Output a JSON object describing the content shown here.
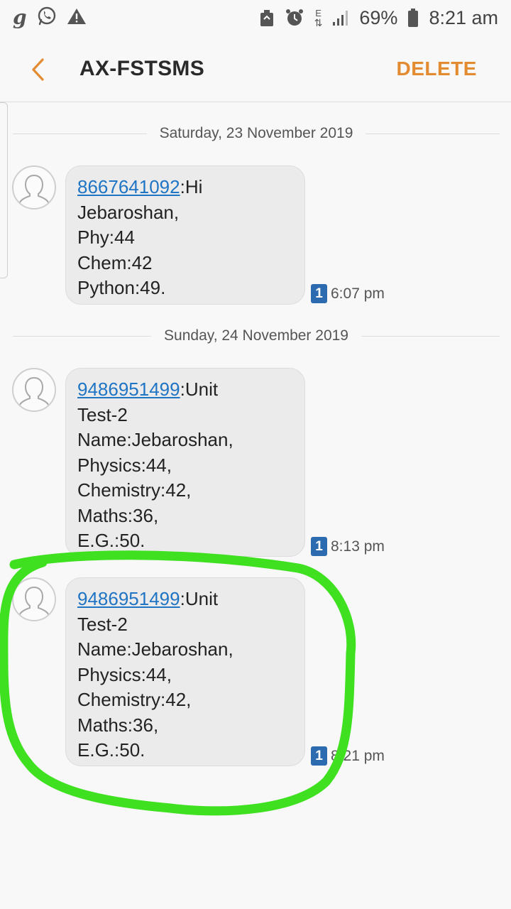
{
  "status_bar": {
    "left_icons": [
      "g-app-icon",
      "whatsapp-icon",
      "warning-icon"
    ],
    "right_icons": [
      "recycle-icon",
      "alarm-icon",
      "data-arrows-icon",
      "signal-icon",
      "battery-icon"
    ],
    "data_indicator": "E",
    "battery": "69%",
    "time": "8:21 am"
  },
  "header": {
    "title": "AX-FSTSMS",
    "delete_label": "DELETE",
    "accent_color": "#e38b30"
  },
  "conversation": {
    "dates": [
      "Saturday, 23 November 2019",
      "Sunday, 24 November 2019"
    ],
    "messages": [
      {
        "sender_number": "8667641092",
        "first_line_rest": ":Hi",
        "lines": [
          "Jebaroshan,",
          "Phy:44",
          "Chem:42",
          "Python:49."
        ],
        "sim": "1",
        "time": "6:07 pm"
      },
      {
        "sender_number": "9486951499",
        "first_line_rest": ":Unit",
        "lines": [
          "Test-2",
          "Name:Jebaroshan,",
          "Physics:44,",
          "Chemistry:42,",
          "Maths:36,",
          "E.G.:50."
        ],
        "sim": "1",
        "time": "8:13 pm"
      },
      {
        "sender_number": "9486951499",
        "first_line_rest": ":Unit",
        "lines": [
          "Test-2",
          "Name:Jebaroshan,",
          "Physics:44,",
          "Chemistry:42,",
          "Maths:36,",
          "E.G.:50."
        ],
        "sim": "1",
        "time": "8:21 pm"
      }
    ]
  },
  "annotation": {
    "color": "#3fe020"
  }
}
